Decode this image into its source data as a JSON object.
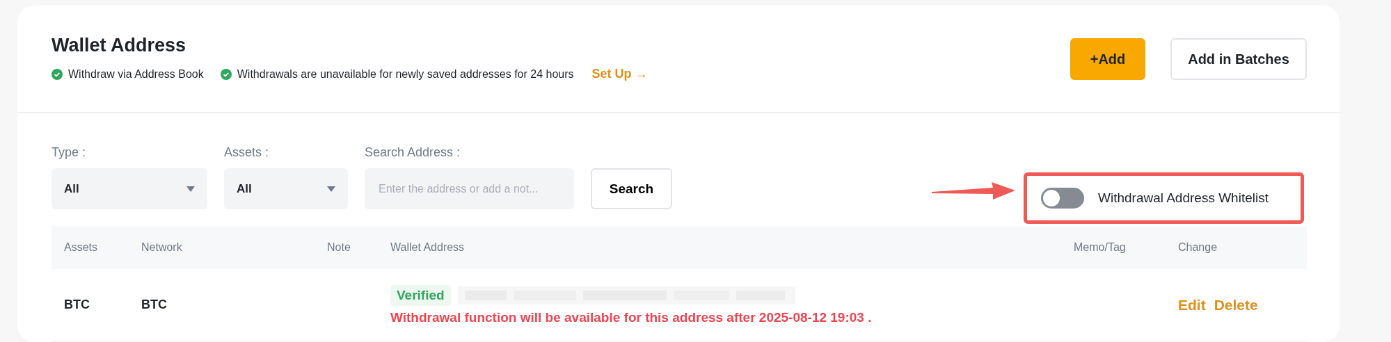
{
  "header": {
    "title": "Wallet Address",
    "notices": [
      {
        "text": "Withdraw via Address Book",
        "checked": true
      },
      {
        "text": "Withdrawals are unavailable for newly saved addresses for 24 hours",
        "checked": true
      }
    ],
    "setup_link": "Set Up →",
    "buttons": [
      {
        "label": "+Add",
        "kind": "primary"
      },
      {
        "label": "Add in Batches",
        "kind": "secondary"
      }
    ]
  },
  "filters": [
    {
      "label": "Type :",
      "kind": "select",
      "value": "All"
    },
    {
      "label": "Assets :",
      "kind": "select",
      "value": "All"
    },
    {
      "label": "Search Address :",
      "kind": "input",
      "placeholder": "Enter the address or add a not..."
    }
  ],
  "search_button": "Search",
  "whitelist_toggle": {
    "label": "Withdrawal Address Whitelist",
    "on": false
  },
  "table": {
    "columns": [
      "Assets",
      "Network",
      "Note",
      "Wallet Address",
      "Memo/Tag",
      "Change"
    ],
    "rows": [
      {
        "asset": "BTC",
        "network": "BTC",
        "badge": "Verified",
        "warning": "Withdrawal function will be available for this address after 2025-08-12 19:03 .",
        "actions": [
          "Edit",
          "Delete"
        ]
      }
    ]
  }
}
